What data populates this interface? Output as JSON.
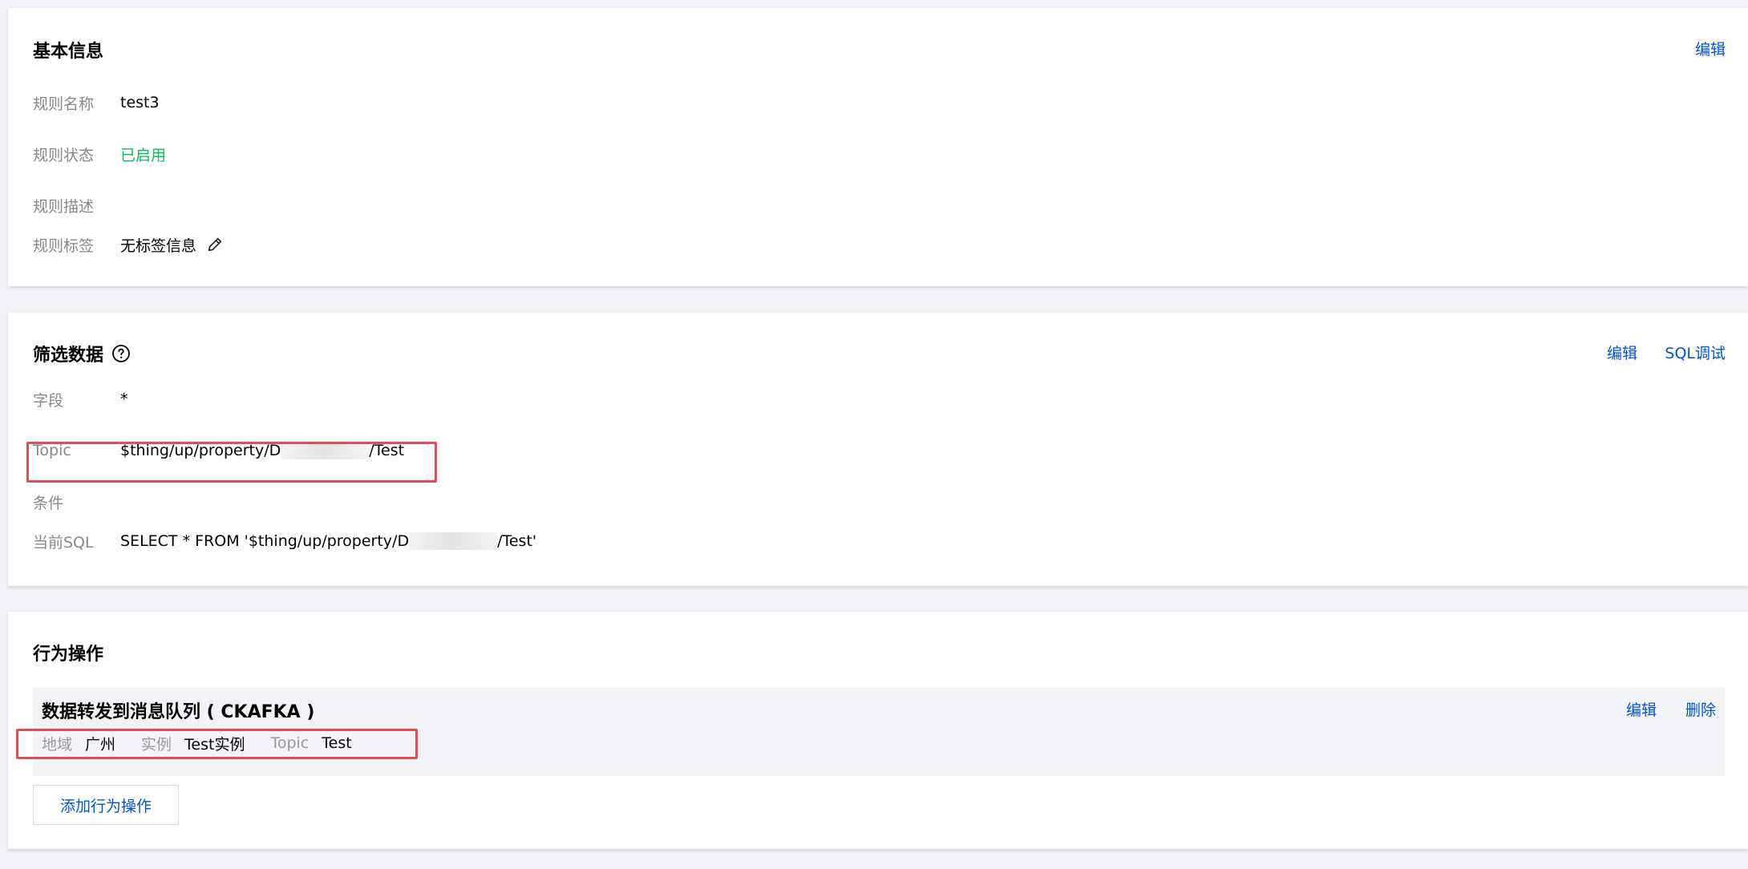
{
  "basic_info": {
    "title": "基本信息",
    "edit_label": "编辑",
    "fields": {
      "name": {
        "label": "规则名称",
        "value": "test3"
      },
      "status": {
        "label": "规则状态",
        "value": "已启用"
      },
      "description": {
        "label": "规则描述",
        "value": ""
      },
      "tags": {
        "label": "规则标签",
        "value": "无标签信息"
      }
    }
  },
  "filter_data": {
    "title": "筛选数据",
    "edit_label": "编辑",
    "sql_debug_label": "SQL调试",
    "fields": {
      "field": {
        "label": "字段",
        "value": "*"
      },
      "topic": {
        "label": "Topic",
        "value_prefix": "$thing/up/property/D",
        "value_suffix": "/Test"
      },
      "condition": {
        "label": "条件",
        "value": ""
      },
      "sql": {
        "label": "当前SQL",
        "value_prefix": "SELECT * FROM '$thing/up/property/D",
        "value_suffix": "/Test'"
      }
    }
  },
  "actions": {
    "title": "行为操作",
    "items": [
      {
        "title": "数据转发到消息队列 ( CKAFKA )",
        "edit_label": "编辑",
        "delete_label": "删除",
        "region_label": "地域",
        "region_value": "广州",
        "instance_label": "实例",
        "instance_value": "Test实例",
        "topic_label": "Topic",
        "topic_value": "Test"
      }
    ],
    "add_button_label": "添加行为操作"
  },
  "colors": {
    "link": "#0052d9",
    "status_enabled": "#0abf5b",
    "highlight": "#e34d59",
    "label": "#888888"
  }
}
